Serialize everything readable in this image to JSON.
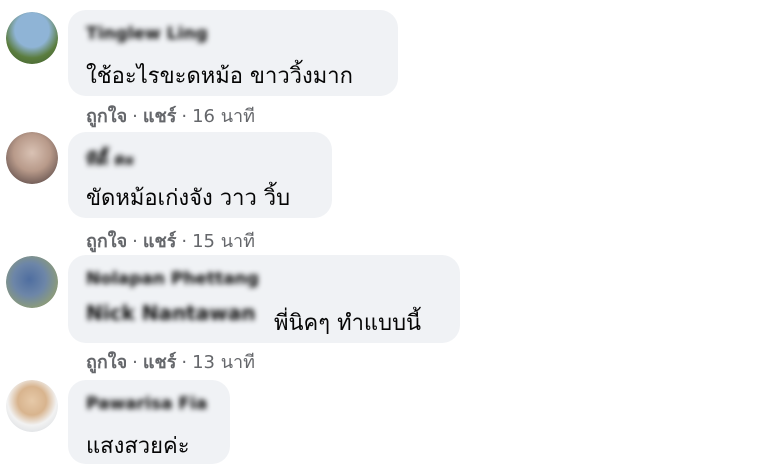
{
  "comments": [
    {
      "author": "Tinglew Ling",
      "text": "ใช้อะไรขะดหม้อ ขาววิ้งมาก",
      "like": "ถูกใจ",
      "share": "แชร์",
      "time": "16 นาที"
    },
    {
      "author": "ทีดี้ คะ",
      "text": "ขัดหม้อเก่งจัง วาว วิ้บ",
      "like": "ถูกใจ",
      "share": "แชร์",
      "time": "15 นาที"
    },
    {
      "author": "Nolapan Phettang",
      "tagged": "Nick Nantawan",
      "text": "พี่นิคๆ ทำแบบนี้",
      "like": "ถูกใจ",
      "share": "แชร์",
      "time": "13 นาที"
    },
    {
      "author": "Pawarisa Fia",
      "text": "แสงสวยค่ะ"
    }
  ],
  "separator": "·",
  "colors": {
    "bubble": "#f0f2f5",
    "text": "#050505",
    "meta": "#65676b"
  }
}
